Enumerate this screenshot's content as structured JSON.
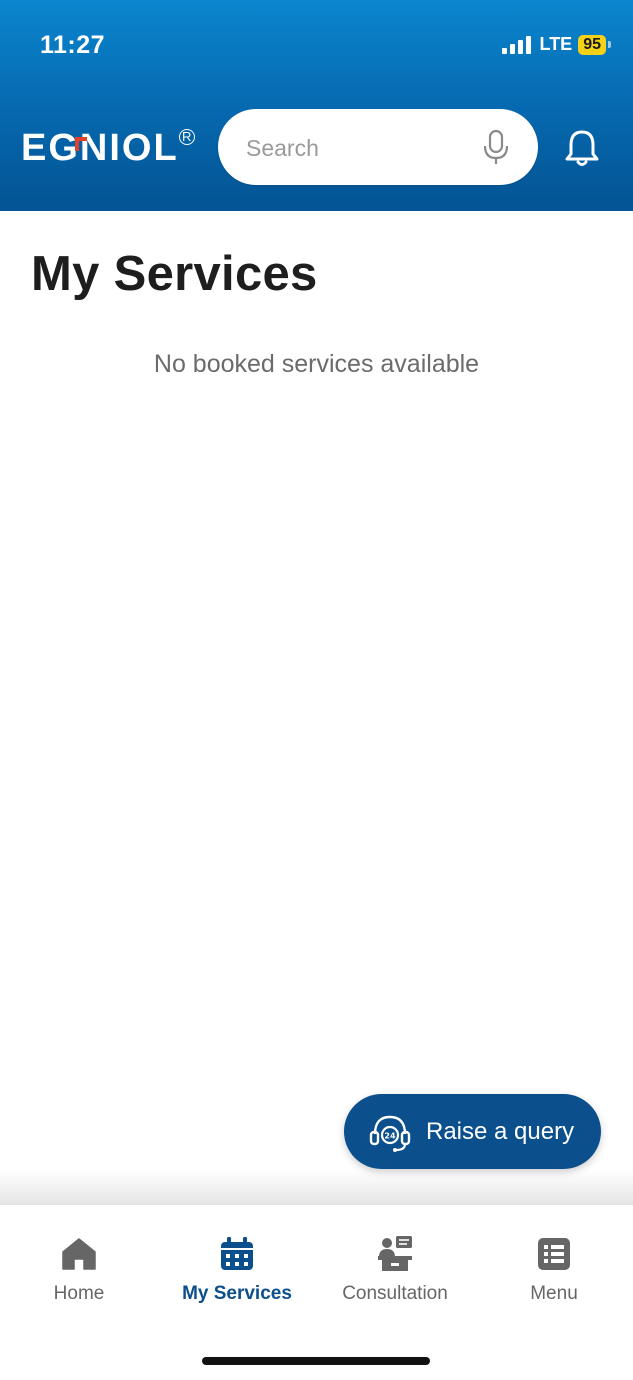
{
  "status_bar": {
    "time": "11:27",
    "network": "LTE",
    "battery": "95"
  },
  "header": {
    "logo": "EGNIOL",
    "search_placeholder": "Search"
  },
  "main": {
    "title": "My Services",
    "empty_message": "No booked services available"
  },
  "query_button": {
    "label": "Raise a query"
  },
  "bottom_nav": {
    "items": [
      {
        "label": "Home",
        "icon": "home-icon",
        "active": false
      },
      {
        "label": "My Services",
        "icon": "calendar-icon",
        "active": true
      },
      {
        "label": "Consultation",
        "icon": "consultation-icon",
        "active": false
      },
      {
        "label": "Menu",
        "icon": "menu-list-icon",
        "active": false
      }
    ]
  },
  "colors": {
    "header_blue": "#0667ad",
    "primary_dark_blue": "#0b4f8d",
    "battery_yellow": "#f5d117",
    "logo_accent": "#e2402b",
    "inactive_gray": "#666666"
  }
}
